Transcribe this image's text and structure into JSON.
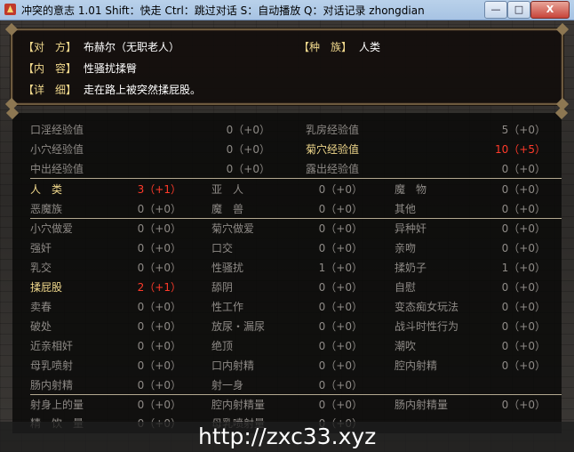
{
  "window": {
    "title": "冲突的意志 1.01 Shift：快走 Ctrl：跳过对话 S：自动播放 Q：对话记录 zhongdian",
    "minimize_label": "—",
    "maximize_label": "□",
    "close_label": "X"
  },
  "info": {
    "opponent_label": "【对　方】",
    "opponent_value": "布赫尔（无职老人）",
    "race_label": "【种　族】",
    "race_value": "人类",
    "content_label": "【内　容】",
    "content_value": "性骚扰揉臀",
    "detail_label": "【详　细】",
    "detail_value": "走在路上被突然揉屁股。"
  },
  "exp_rows": [
    {
      "a": {
        "label": "口淫经验值",
        "value": "0（+0）"
      },
      "b": {
        "label": "乳房经验值",
        "value": "5（+0）"
      }
    },
    {
      "a": {
        "label": "小穴经验值",
        "value": "0（+0）"
      },
      "b": {
        "label": "菊穴经验值",
        "value": "10（+5）"
      }
    },
    {
      "a": {
        "label": "中出经验值",
        "value": "0（+0）"
      },
      "b": {
        "label": "露出经验值",
        "value": "0（+0）"
      }
    }
  ],
  "race_rows": [
    [
      {
        "label": "人　类",
        "value": "3（+1）"
      },
      {
        "label": "亚　人",
        "value": "0（+0）"
      },
      {
        "label": "魔　物",
        "value": "0（+0）"
      }
    ],
    [
      {
        "label": "恶魔族",
        "value": "0（+0）"
      },
      {
        "label": "魔　兽",
        "value": "0（+0）"
      },
      {
        "label": "其他",
        "value": "0（+0）"
      }
    ]
  ],
  "act_rows": [
    [
      {
        "label": "小穴做爱",
        "value": "0（+0）"
      },
      {
        "label": "菊穴做爱",
        "value": "0（+0）"
      },
      {
        "label": "异种奸",
        "value": "0（+0）"
      }
    ],
    [
      {
        "label": "强奸",
        "value": "0（+0）"
      },
      {
        "label": "口交",
        "value": "0（+0）"
      },
      {
        "label": "亲吻",
        "value": "0（+0）"
      }
    ],
    [
      {
        "label": "乳交",
        "value": "0（+0）"
      },
      {
        "label": "性骚扰",
        "value": "1（+0）"
      },
      {
        "label": "揉奶子",
        "value": "1（+0）"
      }
    ],
    [
      {
        "label": "揉屁股",
        "value": "2（+1）"
      },
      {
        "label": "舔阴",
        "value": "0（+0）"
      },
      {
        "label": "自慰",
        "value": "0（+0）"
      }
    ],
    [
      {
        "label": "卖春",
        "value": "0（+0）"
      },
      {
        "label": "性工作",
        "value": "0（+0）"
      },
      {
        "label": "变态痴女玩法",
        "value": "0（+0）"
      }
    ],
    [
      {
        "label": "破处",
        "value": "0（+0）"
      },
      {
        "label": "放尿・漏尿",
        "value": "0（+0）"
      },
      {
        "label": "战斗时性行为",
        "value": "0（+0）"
      }
    ],
    [
      {
        "label": "近亲相奸",
        "value": "0（+0）"
      },
      {
        "label": "绝顶",
        "value": "0（+0）"
      },
      {
        "label": "潮吹",
        "value": "0（+0）"
      }
    ],
    [
      {
        "label": "母乳喷射",
        "value": "0（+0）"
      },
      {
        "label": "口内射精",
        "value": "0（+0）"
      },
      {
        "label": "腔内射精",
        "value": "0（+0）"
      }
    ],
    [
      {
        "label": "肠内射精",
        "value": "0（+0）"
      },
      {
        "label": "射一身",
        "value": "0（+0）"
      }
    ]
  ],
  "bottom_rows": [
    [
      {
        "label": "射身上的量",
        "value": "0（+0）"
      },
      {
        "label": "腔内射精量",
        "value": "0（+0）"
      },
      {
        "label": "肠内射精量",
        "value": "0（+0）"
      }
    ],
    [
      {
        "label": "精　饮　量",
        "value": "0（+0）"
      },
      {
        "label": "母乳喷射量",
        "value": "0（+0）"
      }
    ]
  ],
  "watermark": "http://zxc33.xyz",
  "colors": {
    "label_gold": "#f0d88c",
    "dim": "#8e8a86",
    "highlight_red": "#ff3a2a",
    "border": "#6d5a3e"
  }
}
